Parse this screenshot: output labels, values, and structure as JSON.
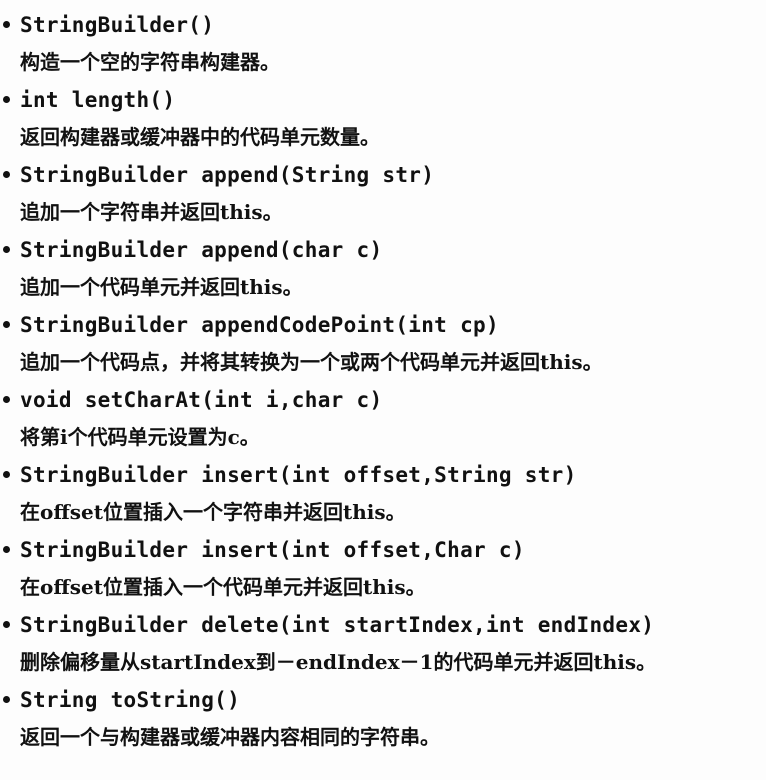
{
  "entries": [
    {
      "signature": "StringBuilder()",
      "description": "构造一个空的字符串构建器。"
    },
    {
      "signature": "int length()",
      "description": "返回构建器或缓冲器中的代码单元数量。"
    },
    {
      "signature": "StringBuilder append(String str)",
      "description": "追加一个字符串并返回this。"
    },
    {
      "signature": "StringBuilder append(char c)",
      "description": "追加一个代码单元并返回this。"
    },
    {
      "signature": "StringBuilder appendCodePoint(int cp)",
      "description": "追加一个代码点，并将其转换为一个或两个代码单元并返回this。"
    },
    {
      "signature": "void setCharAt(int i,char c)",
      "description": "将第i个代码单元设置为c。"
    },
    {
      "signature": "StringBuilder insert(int offset,String str)",
      "description": "在offset位置插入一个字符串并返回this。"
    },
    {
      "signature": "StringBuilder insert(int offset,Char c)",
      "description": "在offset位置插入一个代码单元并返回this。"
    },
    {
      "signature": "StringBuilder delete(int startIndex,int endIndex)",
      "description": "删除偏移量从startIndex到－endIndex－1的代码单元并返回this。"
    },
    {
      "signature": "String toString()",
      "description": "返回一个与构建器或缓冲器内容相同的字符串。"
    }
  ]
}
